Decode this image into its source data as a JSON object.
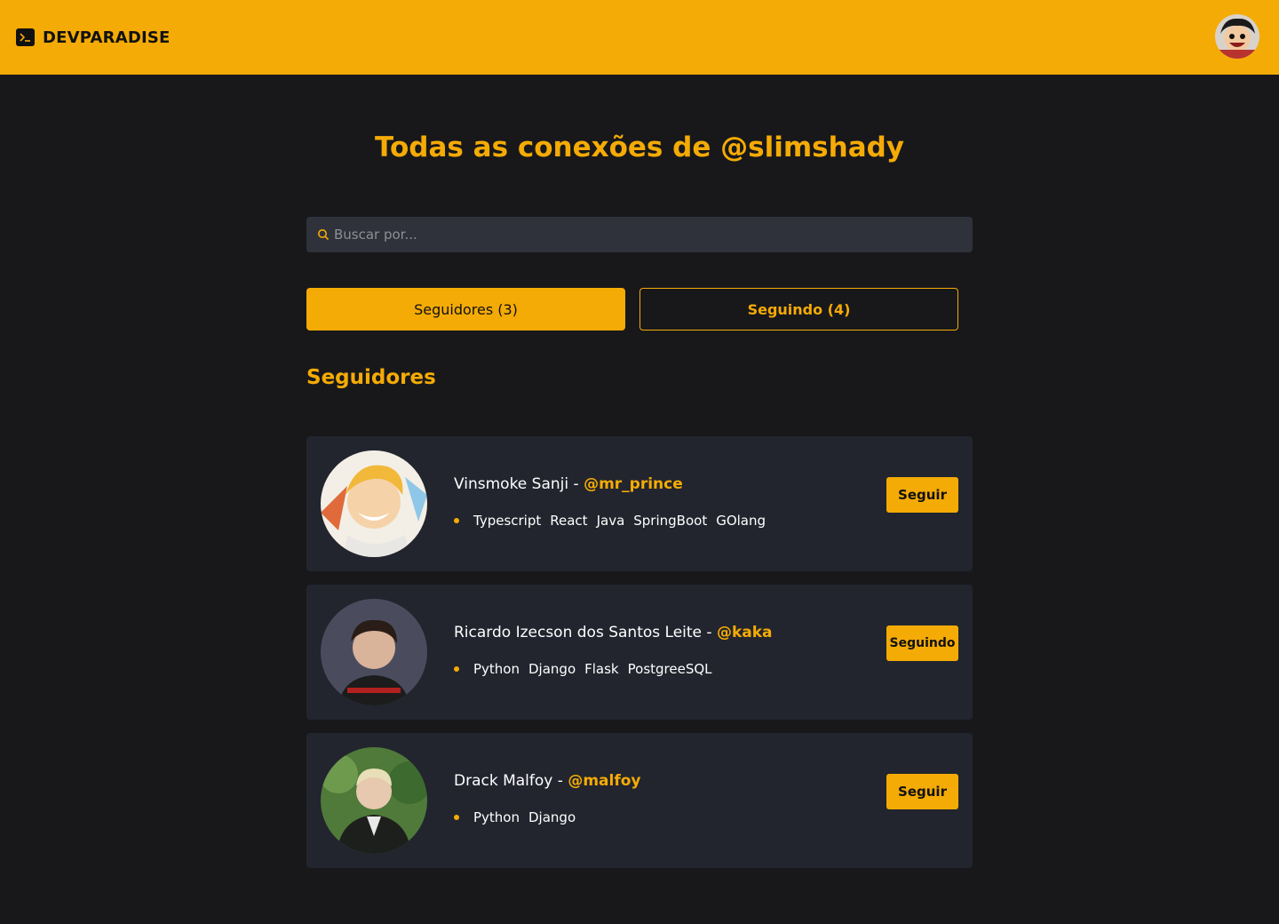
{
  "brand": {
    "name": "DEVPARADISE"
  },
  "page": {
    "title": "Todas as conexões de @slimshady"
  },
  "search": {
    "placeholder": "Buscar por..."
  },
  "tabs": {
    "followers_label": "Seguidores (3)",
    "following_label": "Seguindo (4)"
  },
  "section": {
    "title": "Seguidores"
  },
  "colors": {
    "accent": "#f5ab05",
    "background": "#18181b",
    "card": "#22252e"
  },
  "followers": [
    {
      "name": "Vinsmoke Sanji",
      "separator": " - ",
      "handle": "@mr_prince",
      "skills": [
        "Typescript",
        "React",
        "Java",
        "SpringBoot",
        "GOlang"
      ],
      "action_label": "Seguir"
    },
    {
      "name": "Ricardo Izecson dos Santos Leite",
      "separator": " - ",
      "handle": "@kaka",
      "skills": [
        "Python",
        "Django",
        "Flask",
        "PostgreeSQL"
      ],
      "action_label": "Seguindo"
    },
    {
      "name": "Drack Malfoy",
      "separator": " - ",
      "handle": "@malfoy",
      "skills": [
        "Python",
        "Django"
      ],
      "action_label": "Seguir"
    }
  ]
}
